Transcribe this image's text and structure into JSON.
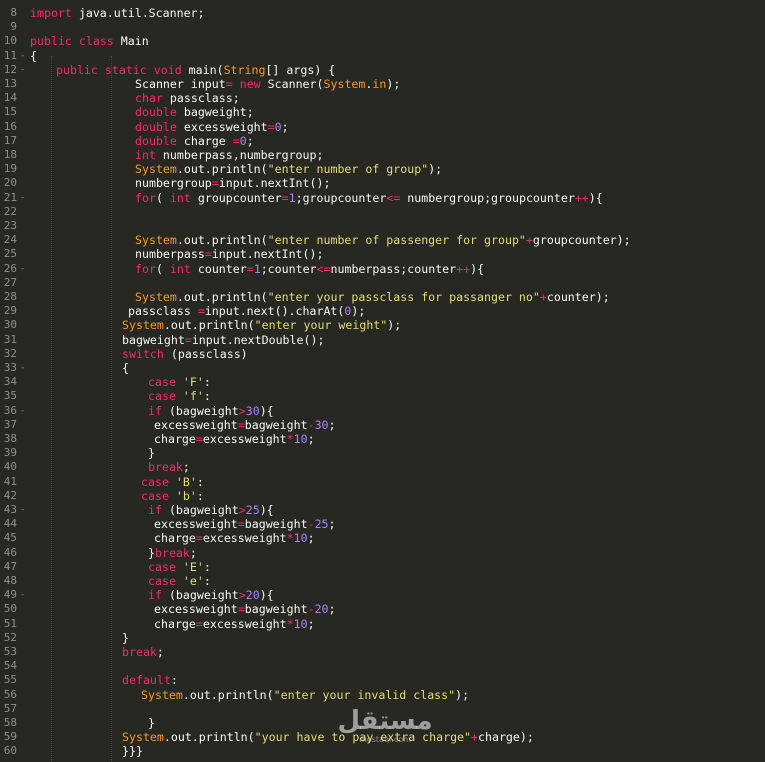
{
  "editor": {
    "theme_colors": {
      "background": "#272822",
      "gutter_text": "#90908a",
      "keyword": "#f92672",
      "type": "#66d9ef",
      "string": "#e6db74",
      "number": "#ae81ff",
      "class": "#fd971f",
      "plain": "#f8f8f2"
    },
    "lines": [
      {
        "n": "8",
        "fold": "",
        "indent": 0,
        "tokens": [
          [
            "kw",
            "import"
          ],
          [
            "id",
            " java.util.Scanner;"
          ]
        ]
      },
      {
        "n": "9",
        "fold": "",
        "indent": 0,
        "tokens": []
      },
      {
        "n": "10",
        "fold": "",
        "indent": 0,
        "tokens": [
          [
            "kw",
            "public"
          ],
          [
            "id",
            " "
          ],
          [
            "kw",
            "class"
          ],
          [
            "id",
            " Main"
          ]
        ]
      },
      {
        "n": "11",
        "fold": "-",
        "indent": 0,
        "tokens": [
          [
            "id",
            "{"
          ]
        ]
      },
      {
        "n": "12",
        "fold": "-",
        "indent": 26,
        "tokens": [
          [
            "kw",
            "public"
          ],
          [
            "id",
            " "
          ],
          [
            "kw",
            "static"
          ],
          [
            "id",
            " "
          ],
          [
            "kw",
            "void"
          ],
          [
            "id",
            " main("
          ],
          [
            "class",
            "String"
          ],
          [
            "id",
            "[] args) {"
          ]
        ]
      },
      {
        "n": "13",
        "fold": "",
        "indent": 105,
        "tokens": [
          [
            "id",
            "Scanner input"
          ],
          [
            "op",
            "="
          ],
          [
            "id",
            " "
          ],
          [
            "kw",
            "new"
          ],
          [
            "id",
            " Scanner("
          ],
          [
            "sys",
            "System"
          ],
          [
            "id",
            "."
          ],
          [
            "sys",
            "in"
          ],
          [
            "id",
            ");"
          ]
        ]
      },
      {
        "n": "14",
        "fold": "",
        "indent": 105,
        "tokens": [
          [
            "kw",
            "char"
          ],
          [
            "id",
            " passclass;"
          ]
        ]
      },
      {
        "n": "15",
        "fold": "",
        "indent": 105,
        "tokens": [
          [
            "kw",
            "double"
          ],
          [
            "id",
            " bagweight;"
          ]
        ]
      },
      {
        "n": "16",
        "fold": "",
        "indent": 105,
        "tokens": [
          [
            "kw",
            "double"
          ],
          [
            "id",
            " excessweight"
          ],
          [
            "op",
            "="
          ],
          [
            "num",
            "0"
          ],
          [
            "id",
            ";"
          ]
        ]
      },
      {
        "n": "17",
        "fold": "",
        "indent": 105,
        "tokens": [
          [
            "kw",
            "double"
          ],
          [
            "id",
            " charge "
          ],
          [
            "op",
            "="
          ],
          [
            "num",
            "0"
          ],
          [
            "id",
            ";"
          ]
        ]
      },
      {
        "n": "18",
        "fold": "",
        "indent": 105,
        "tokens": [
          [
            "kw",
            "int"
          ],
          [
            "id",
            " numberpass,numbergroup;"
          ]
        ]
      },
      {
        "n": "19",
        "fold": "",
        "indent": 105,
        "tokens": [
          [
            "sys",
            "System"
          ],
          [
            "id",
            ".out.println("
          ],
          [
            "str",
            "\"enter number of group\""
          ],
          [
            "id",
            ");"
          ]
        ]
      },
      {
        "n": "20",
        "fold": "",
        "indent": 105,
        "tokens": [
          [
            "id",
            "numbergroup"
          ],
          [
            "op",
            "="
          ],
          [
            "id",
            "input.nextInt();"
          ]
        ]
      },
      {
        "n": "21",
        "fold": "-",
        "indent": 105,
        "tokens": [
          [
            "kw",
            "for"
          ],
          [
            "id",
            "( "
          ],
          [
            "kw",
            "int"
          ],
          [
            "id",
            " groupcounter"
          ],
          [
            "op",
            "="
          ],
          [
            "num",
            "1"
          ],
          [
            "id",
            ";groupcounter"
          ],
          [
            "op",
            "<="
          ],
          [
            "id",
            " numbergroup;groupcounter"
          ],
          [
            "op",
            "++"
          ],
          [
            "id",
            "){"
          ]
        ]
      },
      {
        "n": "22",
        "fold": "",
        "indent": 0,
        "tokens": []
      },
      {
        "n": "23",
        "fold": "",
        "indent": 0,
        "tokens": []
      },
      {
        "n": "24",
        "fold": "",
        "indent": 105,
        "tokens": [
          [
            "sys",
            "System"
          ],
          [
            "id",
            ".out.println("
          ],
          [
            "str",
            "\"enter number of passenger for group\""
          ],
          [
            "op",
            "+"
          ],
          [
            "id",
            "groupcounter);"
          ]
        ]
      },
      {
        "n": "25",
        "fold": "",
        "indent": 105,
        "tokens": [
          [
            "id",
            "numberpass"
          ],
          [
            "op",
            "="
          ],
          [
            "id",
            "input.nextInt();"
          ]
        ]
      },
      {
        "n": "26",
        "fold": "-",
        "indent": 105,
        "tokens": [
          [
            "kw",
            "for"
          ],
          [
            "id",
            "( "
          ],
          [
            "kw",
            "int"
          ],
          [
            "id",
            " counter"
          ],
          [
            "op",
            "="
          ],
          [
            "num",
            "1"
          ],
          [
            "id",
            ";counter"
          ],
          [
            "op",
            "<="
          ],
          [
            "id",
            "numberpass;counter"
          ],
          [
            "op",
            "++"
          ],
          [
            "id",
            "){"
          ]
        ]
      },
      {
        "n": "27",
        "fold": "",
        "indent": 0,
        "tokens": []
      },
      {
        "n": "28",
        "fold": "",
        "indent": 105,
        "tokens": [
          [
            "sys",
            "System"
          ],
          [
            "id",
            ".out.println("
          ],
          [
            "str",
            "\"enter your passclass for passanger no\""
          ],
          [
            "op",
            "+"
          ],
          [
            "id",
            "counter);"
          ]
        ]
      },
      {
        "n": "29",
        "fold": "",
        "indent": 98,
        "tokens": [
          [
            "id",
            "passclass "
          ],
          [
            "op",
            "="
          ],
          [
            "id",
            "input.next().charAt("
          ],
          [
            "num",
            "0"
          ],
          [
            "id",
            ");"
          ]
        ]
      },
      {
        "n": "30",
        "fold": "",
        "indent": 92,
        "tokens": [
          [
            "sys",
            "System"
          ],
          [
            "id",
            ".out.println("
          ],
          [
            "str",
            "\"enter your weight\""
          ],
          [
            "id",
            ");"
          ]
        ]
      },
      {
        "n": "31",
        "fold": "",
        "indent": 92,
        "tokens": [
          [
            "id",
            "bagweight"
          ],
          [
            "op",
            "="
          ],
          [
            "id",
            "input.nextDouble();"
          ]
        ]
      },
      {
        "n": "32",
        "fold": "",
        "indent": 92,
        "tokens": [
          [
            "kw",
            "switch"
          ],
          [
            "id",
            " (passclass)"
          ]
        ]
      },
      {
        "n": "33",
        "fold": "-",
        "indent": 92,
        "tokens": [
          [
            "id",
            "{"
          ]
        ]
      },
      {
        "n": "34",
        "fold": "",
        "indent": 118,
        "tokens": [
          [
            "kw",
            "case"
          ],
          [
            "id",
            " "
          ],
          [
            "str",
            "'F'"
          ],
          [
            "id",
            ":"
          ]
        ]
      },
      {
        "n": "35",
        "fold": "",
        "indent": 118,
        "tokens": [
          [
            "kw",
            "case"
          ],
          [
            "id",
            " "
          ],
          [
            "str",
            "'f'"
          ],
          [
            "id",
            ":"
          ]
        ]
      },
      {
        "n": "36",
        "fold": "-",
        "indent": 118,
        "tokens": [
          [
            "kw",
            "if"
          ],
          [
            "id",
            " (bagweight"
          ],
          [
            "op",
            ">"
          ],
          [
            "num",
            "30"
          ],
          [
            "id",
            "){"
          ]
        ]
      },
      {
        "n": "37",
        "fold": "",
        "indent": 124,
        "tokens": [
          [
            "id",
            "excessweight"
          ],
          [
            "op",
            "="
          ],
          [
            "id",
            "bagweight"
          ],
          [
            "op",
            "-"
          ],
          [
            "num",
            "30"
          ],
          [
            "id",
            ";"
          ]
        ]
      },
      {
        "n": "38",
        "fold": "",
        "indent": 124,
        "tokens": [
          [
            "id",
            "charge"
          ],
          [
            "op",
            "="
          ],
          [
            "id",
            "excessweight"
          ],
          [
            "op",
            "*"
          ],
          [
            "num",
            "10"
          ],
          [
            "id",
            ";"
          ]
        ]
      },
      {
        "n": "39",
        "fold": "",
        "indent": 118,
        "tokens": [
          [
            "id",
            "}"
          ]
        ]
      },
      {
        "n": "40",
        "fold": "",
        "indent": 118,
        "tokens": [
          [
            "kw",
            "break"
          ],
          [
            "id",
            ";"
          ]
        ]
      },
      {
        "n": "41",
        "fold": "",
        "indent": 111,
        "tokens": [
          [
            "kw",
            "case"
          ],
          [
            "id",
            " "
          ],
          [
            "str",
            "'B'"
          ],
          [
            "id",
            ":"
          ]
        ]
      },
      {
        "n": "42",
        "fold": "",
        "indent": 111,
        "tokens": [
          [
            "kw",
            "case"
          ],
          [
            "id",
            " "
          ],
          [
            "str",
            "'b'"
          ],
          [
            "id",
            ":"
          ]
        ]
      },
      {
        "n": "43",
        "fold": "-",
        "indent": 118,
        "tokens": [
          [
            "kw",
            "if"
          ],
          [
            "id",
            " (bagweight"
          ],
          [
            "op",
            ">"
          ],
          [
            "num",
            "25"
          ],
          [
            "id",
            "){"
          ]
        ]
      },
      {
        "n": "44",
        "fold": "",
        "indent": 124,
        "tokens": [
          [
            "id",
            "excessweight"
          ],
          [
            "op",
            "="
          ],
          [
            "id",
            "bagweight"
          ],
          [
            "op",
            "-"
          ],
          [
            "num",
            "25"
          ],
          [
            "id",
            ";"
          ]
        ]
      },
      {
        "n": "45",
        "fold": "",
        "indent": 124,
        "tokens": [
          [
            "id",
            "charge"
          ],
          [
            "op",
            "="
          ],
          [
            "id",
            "excessweight"
          ],
          [
            "op",
            "*"
          ],
          [
            "num",
            "10"
          ],
          [
            "id",
            ";"
          ]
        ]
      },
      {
        "n": "46",
        "fold": "",
        "indent": 118,
        "tokens": [
          [
            "id",
            "}"
          ],
          [
            "kw",
            "break"
          ],
          [
            "id",
            ";"
          ]
        ]
      },
      {
        "n": "47",
        "fold": "",
        "indent": 118,
        "tokens": [
          [
            "kw",
            "case"
          ],
          [
            "id",
            " "
          ],
          [
            "str",
            "'E'"
          ],
          [
            "id",
            ":"
          ]
        ]
      },
      {
        "n": "48",
        "fold": "",
        "indent": 118,
        "tokens": [
          [
            "kw",
            "case"
          ],
          [
            "id",
            " "
          ],
          [
            "str",
            "'e'"
          ],
          [
            "id",
            ":"
          ]
        ]
      },
      {
        "n": "49",
        "fold": "-",
        "indent": 118,
        "tokens": [
          [
            "kw",
            "if"
          ],
          [
            "id",
            " (bagweight"
          ],
          [
            "op",
            ">"
          ],
          [
            "num",
            "20"
          ],
          [
            "id",
            "){"
          ]
        ]
      },
      {
        "n": "50",
        "fold": "",
        "indent": 124,
        "tokens": [
          [
            "id",
            "excessweight"
          ],
          [
            "op",
            "="
          ],
          [
            "id",
            "bagweight"
          ],
          [
            "op",
            "-"
          ],
          [
            "num",
            "20"
          ],
          [
            "id",
            ";"
          ]
        ]
      },
      {
        "n": "51",
        "fold": "",
        "indent": 124,
        "tokens": [
          [
            "id",
            "charge"
          ],
          [
            "op",
            "="
          ],
          [
            "id",
            "excessweight"
          ],
          [
            "op",
            "*"
          ],
          [
            "num",
            "10"
          ],
          [
            "id",
            ";"
          ]
        ]
      },
      {
        "n": "52",
        "fold": "",
        "indent": 92,
        "tokens": [
          [
            "id",
            "}"
          ]
        ]
      },
      {
        "n": "53",
        "fold": "",
        "indent": 92,
        "tokens": [
          [
            "kw",
            "break"
          ],
          [
            "id",
            ";"
          ]
        ]
      },
      {
        "n": "54",
        "fold": "",
        "indent": 0,
        "tokens": []
      },
      {
        "n": "55",
        "fold": "",
        "indent": 92,
        "tokens": [
          [
            "kw",
            "default"
          ],
          [
            "id",
            ":"
          ]
        ]
      },
      {
        "n": "56",
        "fold": "",
        "indent": 111,
        "tokens": [
          [
            "sys",
            "System"
          ],
          [
            "id",
            ".out.println("
          ],
          [
            "str",
            "\"enter your invalid class\""
          ],
          [
            "id",
            ");"
          ]
        ]
      },
      {
        "n": "57",
        "fold": "",
        "indent": 0,
        "tokens": []
      },
      {
        "n": "58",
        "fold": "",
        "indent": 118,
        "tokens": [
          [
            "id",
            "}"
          ]
        ]
      },
      {
        "n": "59",
        "fold": "",
        "indent": 92,
        "tokens": [
          [
            "sys",
            "System"
          ],
          [
            "id",
            ".out.println("
          ],
          [
            "str",
            "\"your have to pay extra charge\""
          ],
          [
            "op",
            "+"
          ],
          [
            "id",
            "charge);"
          ]
        ]
      },
      {
        "n": "60",
        "fold": "",
        "indent": 92,
        "tokens": [
          [
            "id",
            "}}}"
          ]
        ]
      }
    ]
  },
  "watermark": {
    "logo_text": "مستقل",
    "sub_text": "mostaql.com"
  }
}
